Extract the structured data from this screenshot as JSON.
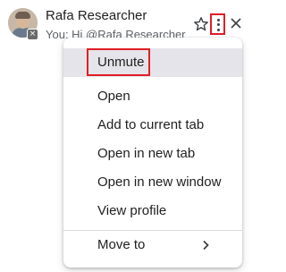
{
  "chat": {
    "name": "Rafa Researcher",
    "preview": "You: Hi @Rafa Researcher"
  },
  "menu": {
    "items": [
      {
        "label": "Unmute"
      },
      {
        "label": "Open"
      },
      {
        "label": "Add to current tab"
      },
      {
        "label": "Open in new tab"
      },
      {
        "label": "Open in new window"
      },
      {
        "label": "View profile"
      },
      {
        "label": "Move to"
      }
    ]
  },
  "icons": {
    "star": "star-icon",
    "more": "more-vert-icon",
    "close": "close-icon",
    "mute_badge": "mute-badge-icon",
    "chevron": "chevron-right-icon"
  },
  "colors": {
    "highlight_border": "#e01e25",
    "hover_background": "#e4e4ea",
    "text_primary": "#1f1f1f",
    "text_secondary": "#5f6368"
  }
}
